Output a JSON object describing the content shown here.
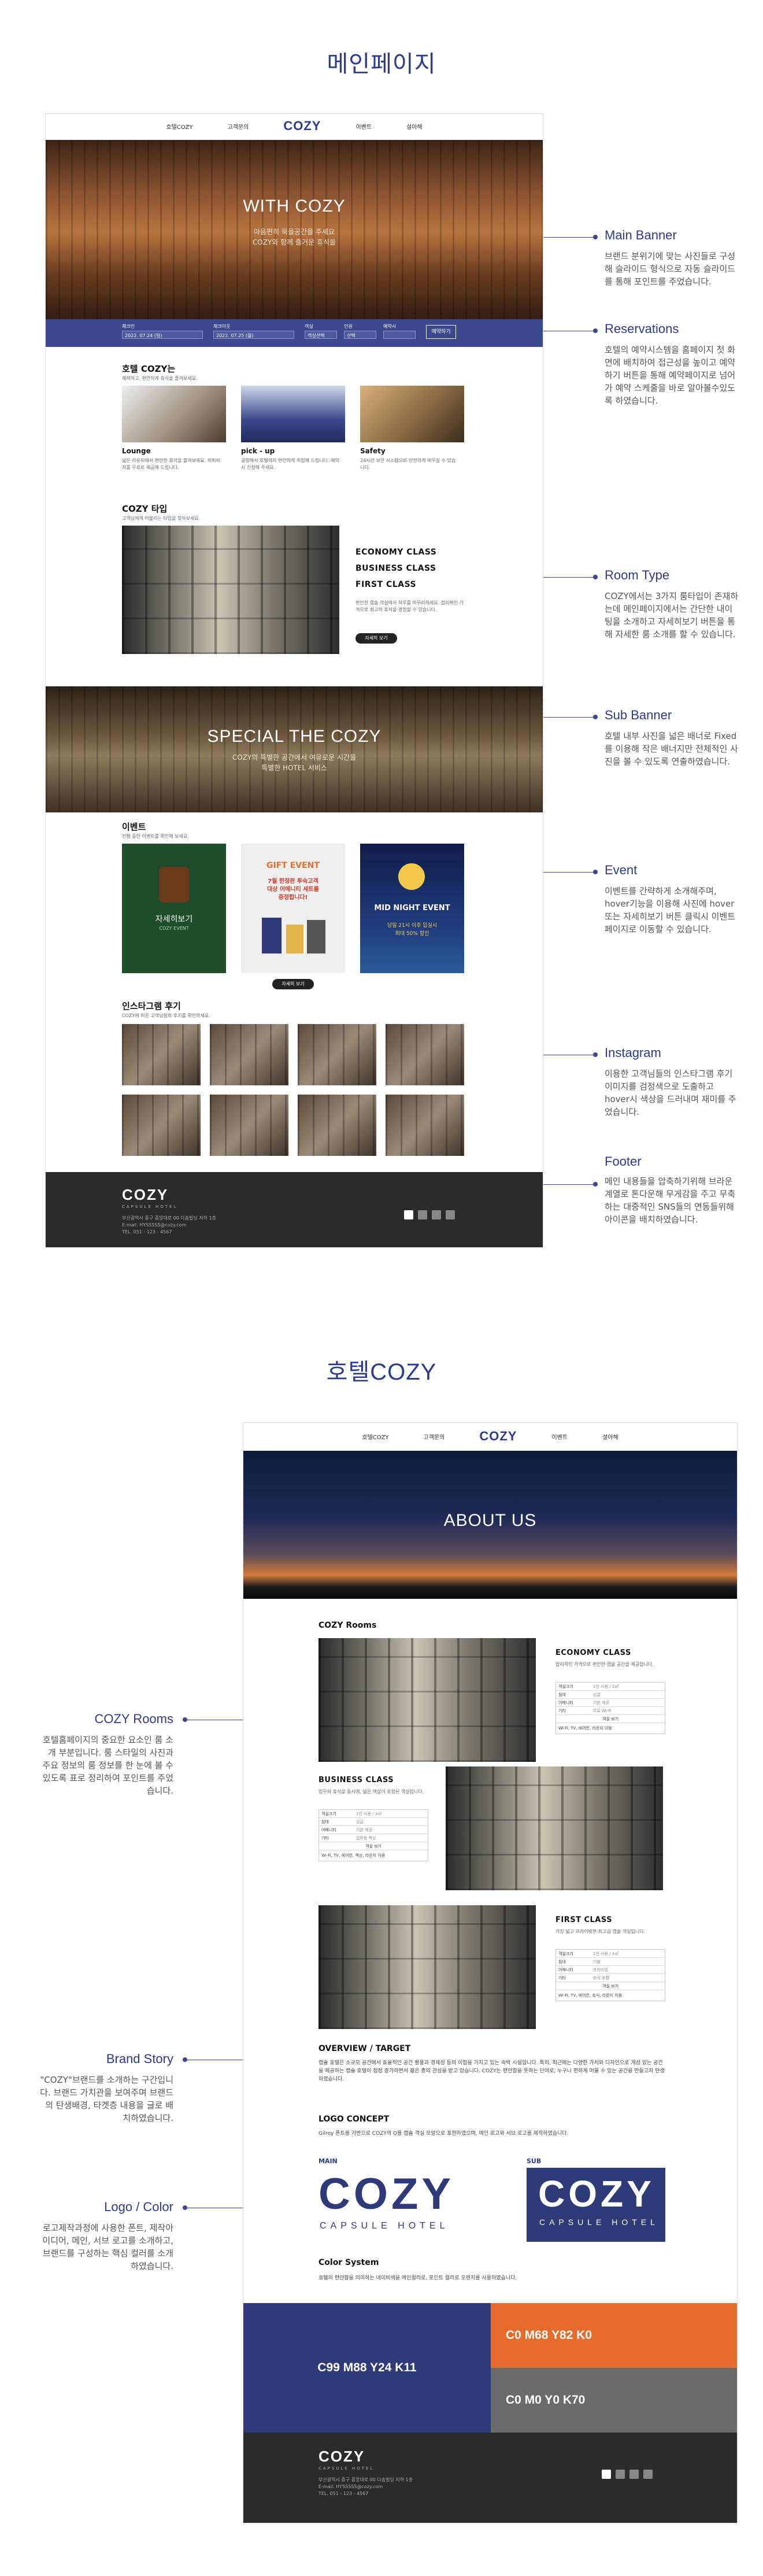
{
  "titles": {
    "main_page": "메인페이지",
    "hotel_page": "호텔COZY"
  },
  "nav": {
    "items": [
      "호텔COZY",
      "고객문의",
      "이벤트",
      "설아해",
      "이벤트",
      "설아해"
    ],
    "logo": "COZY"
  },
  "main_banner": {
    "title": "WITH COZY",
    "sub1": "마음편히 묵을공간을 주세요",
    "sub2": "COZY와 함께 즐거운 휴식을"
  },
  "reservation": {
    "fields": [
      "체크인",
      "체크아웃",
      "객실",
      "인원",
      "예약시"
    ],
    "values": [
      "2022. 07.24 (일)",
      "2022. 07.25 (월)",
      "객실선택",
      "선택",
      "예약시"
    ],
    "button": "예약하기"
  },
  "hotel_intro": {
    "title": "호텔 COZY는",
    "sub": "쾌적하고, 편안하게 휴식을 즐겨보세요.",
    "cards": [
      {
        "title": "Lounge",
        "desc": "넓은 라운지에서 편안한 휴식을 즐겨보세요. 커피와 차를 무료로 제공해 드립니다."
      },
      {
        "title": "pick - up",
        "desc": "공항에서 호텔까지 편안하게 픽업해 드립니다. 예약 시 신청해 주세요."
      },
      {
        "title": "Safety",
        "desc": "24시간 보안 시스템으로 안전하게 머무실 수 있습니다."
      }
    ]
  },
  "room_type": {
    "title": "COZY 타입",
    "sub": "고객님에게 어울리는 타입을 찾아보세요.",
    "types": [
      "ECONOMY CLASS",
      "BUSINESS CLASS",
      "FIRST CLASS"
    ],
    "desc": "편안한 캡슐 객실에서 하루를 마무리하세요. 합리적인 가격으로 최고의 휴식을 경험할 수 있습니다.",
    "button": "자세히 보기"
  },
  "sub_banner": {
    "title": "SPECIAL THE COZY",
    "sub1": "COZY의 특별한 공간에서 여유로운 시간을",
    "sub2": "특별한 HOTEL 서비스"
  },
  "events": {
    "title": "이벤트",
    "sub": "진행 중인 이벤트를 확인해 보세요.",
    "cards": [
      {
        "title": "자세히보기",
        "sub": "COZY EVENT"
      },
      {
        "title": "GIFT EVENT",
        "line1": "7월 한정판 투숙고객",
        "line2": "대상 어메니티 세트를",
        "line3": "증정합니다!"
      },
      {
        "title": "MID NIGHT EVENT",
        "line1": "당일 21시 이후 입실시",
        "line2": "최대 50% 할인"
      }
    ],
    "button": "자세히 보기"
  },
  "instagram": {
    "title": "인스타그램 후기",
    "sub": "COZY에 머문 고객님들의 후기를 확인하세요."
  },
  "footer": {
    "logo": "COZY",
    "logo_sub": "CAPSULE HOTEL",
    "lines": [
      "부산광역시 중구 중앙대로 00 다솜빌딩 지하 1층",
      "E-mail. HYSSSSS@cozy.com",
      "TEL. 051 - 123 - 4567"
    ]
  },
  "annotations": [
    {
      "title": "Main Banner",
      "desc": "브랜드 분위기에 맞는 사진들로 구성해 슬라이드 형식으로 자동 슬라이드를 통해 포인트를 주었습니다."
    },
    {
      "title": "Reservations",
      "desc": "호텔의 예약시스템을 홈페이지 첫 화면에 배치하여 접근성을 높이고 예약하기 버튼을 통해 예약페이지로 넘어가 예약 스케줄을 바로 알아볼수있도록 하였습니다."
    },
    {
      "title": "Room Type",
      "desc": "COZY에서는 3가지 룸타입이 존재하는데 메인페이지에서는 간단한 내이팅을 소개하고 자세히보기 버튼을 통해 자세한 룸 소개를 할 수 있습니다."
    },
    {
      "title": "Sub Banner",
      "desc": "호텔 내부 사진을 넓은 배너로 Fixed를 이용해 작은 배너지만 전체적인 사진을 볼 수 있도록 연출하였습니다."
    },
    {
      "title": "Event",
      "desc": "이벤트를 간략하게 소개해주며, hover기능을 이용해 사진에 hover 또는 자세히보기 버튼 클릭시 이벤트 페이지로 이동할 수 있습니다."
    },
    {
      "title": "Instagram",
      "desc": "이용한 고객님들의 인스타그램 후기 이미지를 검정색으로 도출하고 hover시 색상을 드러내며 재미를 주었습니다."
    },
    {
      "title": "Footer",
      "desc": "메인 내용들을 압축하기위해 브라운계열로 톤다운해 무게감을 주고 무축하는 대중적인 SNS들의 연동들위해 아이콘을 배치하였습니다."
    },
    {
      "title": "COZY Rooms",
      "desc": "호텔홈페이지의 중요한 요소인 룸 소개 부분입니다. 룸 스타일의 사진과 주요 정보의 룸 정보를 한 눈에 볼 수 있도록 표로 정리하여 포인트를 주었습니다."
    },
    {
      "title": "Brand Story",
      "desc": "\"COZY\"브랜드를 소개하는 구간입니다. 브랜드 가치관을 보여주며 브랜드의 탄생배경, 타겟층 내용을 글로 배치하였습니다."
    },
    {
      "title": "Logo / Color",
      "desc": "로고제작과정에 사용한 폰트, 제작아이디어, 메인, 서브 로고를 소개하고, 브랜드를 구성하는 핵심 컬러를 소개하였습니다."
    }
  ],
  "hotel": {
    "banner_title": "ABOUT US",
    "rooms_title": "COZY Rooms",
    "classes": [
      {
        "name": "ECONOMY CLASS",
        "desc": "합리적인 가격으로 편안한 캡슐 공간을 제공합니다.",
        "specs": [
          [
            "객실크기",
            "1인 사용 / 2㎡"
          ],
          [
            "침대",
            "싱글"
          ],
          [
            "어메니티",
            "기본 제공"
          ],
          [
            "기타",
            "무료 Wi-Fi"
          ]
        ],
        "button": "객실 보기",
        "note": "Wi-Fi, TV, 에어컨, 라운지 이용"
      },
      {
        "name": "BUSINESS CLASS",
        "desc": "업무와 휴식을 동시에, 넓은 책상이 포함된 객실입니다.",
        "specs": [
          [
            "객실크기",
            "1인 사용 / 3㎡"
          ],
          [
            "침대",
            "싱글"
          ],
          [
            "어메니티",
            "기본 제공"
          ],
          [
            "기타",
            "업무용 책상"
          ]
        ],
        "button": "객실 보기",
        "note": "Wi-Fi, TV, 에어컨, 책상, 라운지 이용"
      },
      {
        "name": "FIRST CLASS",
        "desc": "가장 넓고 프라이빗한 최고급 캡슐 객실입니다.",
        "specs": [
          [
            "객실크기",
            "1인 사용 / 4㎡"
          ],
          [
            "침대",
            "더블"
          ],
          [
            "어메니티",
            "프리미엄"
          ],
          [
            "기타",
            "조식 포함"
          ]
        ],
        "button": "객실 보기",
        "note": "Wi-Fi, TV, 에어컨, 조식, 라운지 이용"
      }
    ],
    "story_title": "OVERVIEW / TARGET",
    "story": "캡슐 호텔은 소규모 공간에서 효율적인 공간 활용과 경제성 등의 이점을 가지고 있는 숙박 시설입니다. 특히, 최근에는 다양한 가치와 디자인으로 개성 있는 공간을 제공하는 캡슐 호텔이 점점 증가하면서 젊은 층의 관심을 받고 있습니다. COZY는 편안함을 뜻하는 단어로, 누구나 편하게 머물 수 있는 공간을 만들고자 탄생하였습니다.",
    "logo_title": "LOGO CONCEPT",
    "logo_desc": "Gilroy 폰트를 기반으로 COZY의 O를 캡슐 객실 모양으로 표현하였으며, 메인 로고와 서브 로고를 제작하였습니다.",
    "main_label": "MAIN",
    "sub_label": "SUB",
    "logo_word": "COZY",
    "logo_caption": "CAPSULE HOTEL",
    "color_title": "Color System",
    "color_desc": "호텔의 편안함을 의미하는 네이비색을 메인컬러로, 포인트 컬러로 오렌지를 사용하였습니다.",
    "colors": [
      {
        "label": "C99 M88 Y24 K11",
        "hex": "#2f3b78"
      },
      {
        "label": "C0 M68 Y82 K0",
        "hex": "#e86b2e"
      },
      {
        "label": "C0 M0 Y0 K70",
        "hex": "#6b6b6b"
      }
    ]
  }
}
